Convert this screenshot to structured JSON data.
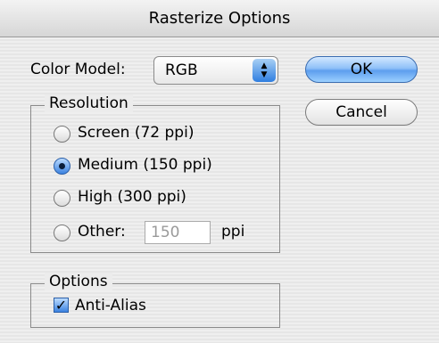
{
  "dialog": {
    "title": "Rasterize Options"
  },
  "color_model": {
    "label": "Color Model:",
    "selected": "RGB"
  },
  "buttons": {
    "ok": "OK",
    "cancel": "Cancel"
  },
  "resolution": {
    "legend": "Resolution",
    "options": [
      {
        "label": "Screen (72 ppi)",
        "selected": false
      },
      {
        "label": "Medium (150 ppi)",
        "selected": true
      },
      {
        "label": "High (300 ppi)",
        "selected": false
      },
      {
        "label": "Other:",
        "selected": false
      }
    ],
    "other_value": "150",
    "other_unit": "ppi"
  },
  "options": {
    "legend": "Options",
    "anti_alias_label": "Anti-Alias",
    "anti_alias_checked": true
  },
  "icons": {
    "popup_arrows": "up-down-arrows-icon",
    "checkmark": "checkmark-icon"
  },
  "colors": {
    "accent": "#3b82e0",
    "default_button": "#8fc0f8"
  }
}
